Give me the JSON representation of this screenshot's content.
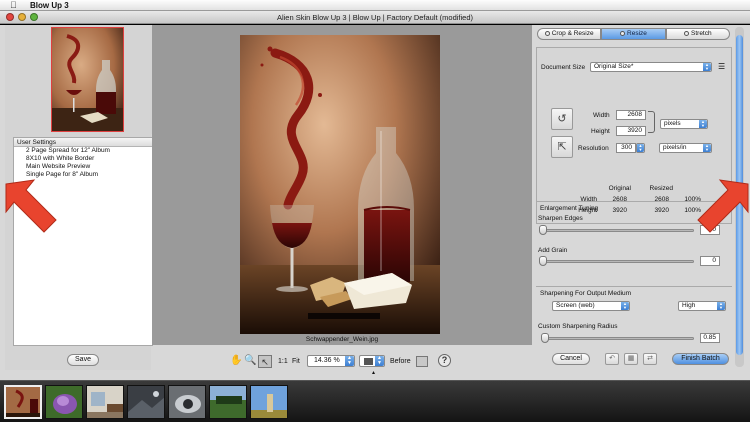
{
  "menubar": {
    "app_name": "Blow Up 3"
  },
  "window": {
    "title": "Alien Skin Blow Up 3 | Blow Up | Factory Default (modified)"
  },
  "presets": {
    "header": "User Settings",
    "items": [
      "2 Page Spread for 12\" Album",
      "8X10 with White Border",
      "Main Website Preview",
      "Single Page for 8\" Album"
    ],
    "save_label": "Save"
  },
  "canvas": {
    "filename": "Schwappender_Wein.jpg"
  },
  "toolbar": {
    "one_to_one": "1:1",
    "fit": "Fit",
    "zoom_value": "14.36 %",
    "before_label": "Before",
    "help_label": "?"
  },
  "tabs": [
    {
      "label": "Crop & Resize",
      "active": false
    },
    {
      "label": "Resize",
      "active": true
    },
    {
      "label": "Stretch",
      "active": false
    }
  ],
  "resize": {
    "document_size_label": "Document Size",
    "document_size_value": "Original Size*",
    "width_label": "Width",
    "width_value": "2608",
    "height_label": "Height",
    "height_value": "3920",
    "units_value": "pixels",
    "resolution_label": "Resolution",
    "resolution_value": "300",
    "resolution_units": "pixels/in",
    "table": {
      "col_original": "Original",
      "col_resized": "Resized",
      "rows": [
        {
          "label": "Width",
          "original": "2608",
          "resized": "2608",
          "percent": "100%"
        },
        {
          "label": "Height",
          "original": "3920",
          "resized": "3920",
          "percent": "100%"
        }
      ]
    }
  },
  "enlargement": {
    "title": "Enlargement Tuning",
    "sharpen_edges_label": "Sharpen Edges",
    "sharpen_edges_value": "0",
    "add_grain_label": "Add Grain",
    "add_grain_value": "0"
  },
  "output_sharpening": {
    "title": "Sharpening For Output Medium",
    "medium_value": "Screen (web)",
    "amount_value": "High",
    "radius_label": "Custom Sharpening Radius",
    "radius_value": "0.85"
  },
  "footer": {
    "cancel_label": "Cancel",
    "finish_label": "Finish Batch"
  },
  "colors": {
    "accent": "#5b9ae4",
    "arrow": "#e8442e"
  }
}
